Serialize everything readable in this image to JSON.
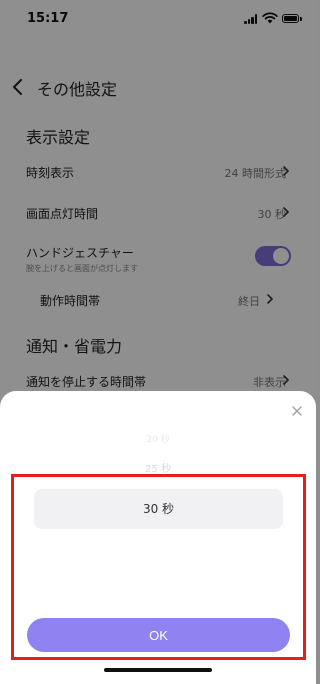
{
  "status_bar": {
    "time": "15:17"
  },
  "header": {
    "title": "その他設定"
  },
  "sections": {
    "display": {
      "title": "表示設定",
      "time_format": {
        "label": "時刻表示",
        "value": "24 時間形式"
      },
      "screen_on": {
        "label": "画面点灯時間",
        "value": "30 秒"
      },
      "hand_gesture": {
        "label": "ハンドジェスチャー",
        "sub": "腕を上げると画面が点灯します",
        "enabled": true
      },
      "active_hours": {
        "label": "動作時間帯",
        "value": "終日"
      }
    },
    "notification": {
      "title": "通知・省電力",
      "quiet_hours": {
        "label": "通知を停止する時間帯",
        "value": "非表示"
      }
    }
  },
  "sheet": {
    "close_icon": "close-icon",
    "picker_faded_1": "20 秒",
    "picker_faded_2": "25 秒",
    "picker_selected": "30 秒",
    "ok_label": "OK"
  },
  "colors": {
    "accent": "#8e83f0",
    "toggle": "#7b6fd6",
    "highlight": "#e4201c"
  }
}
